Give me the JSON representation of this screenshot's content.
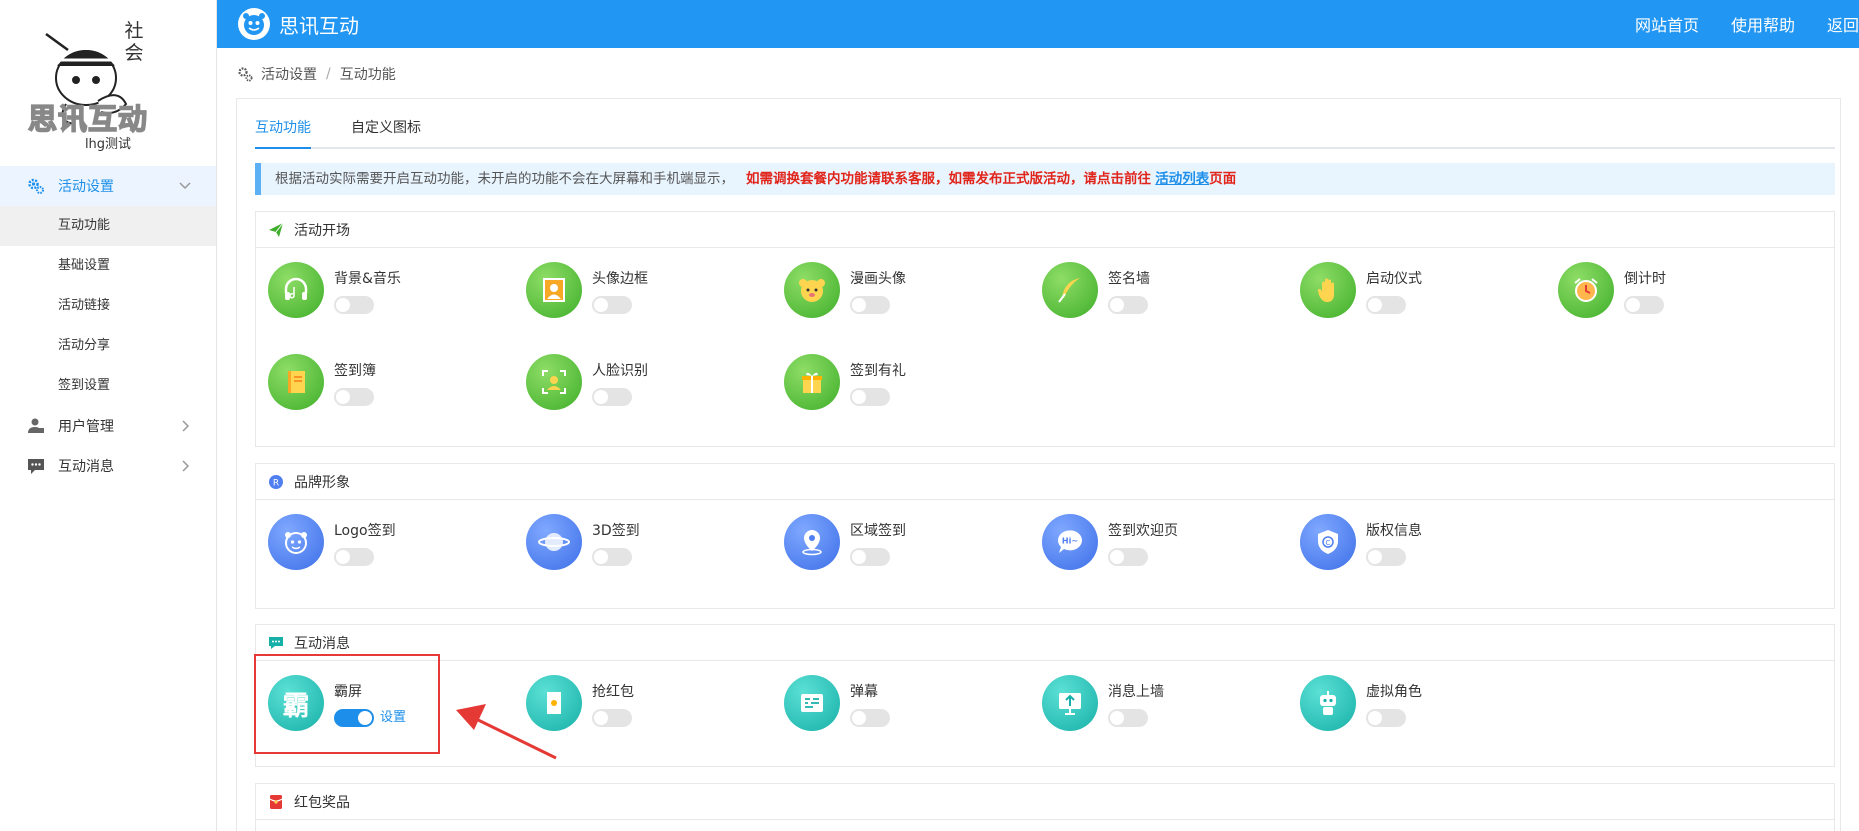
{
  "sidebar": {
    "logo_text": "思讯互动",
    "logo_stamp": "社会",
    "username": "lhg测试",
    "menu": [
      {
        "label": "活动设置",
        "children": [
          "互动功能",
          "基础设置",
          "活动链接",
          "活动分享",
          "签到设置"
        ]
      },
      {
        "label": "用户管理"
      },
      {
        "label": "互动消息"
      }
    ]
  },
  "topbar": {
    "title": "思讯互动",
    "links": [
      "网站首页",
      "使用帮助",
      "返回"
    ]
  },
  "breadcrumb": {
    "items": [
      "活动设置",
      "互动功能"
    ],
    "separator": "/"
  },
  "tabs": [
    "互动功能",
    "自定义图标"
  ],
  "notice": {
    "text": "根据活动实际需要开启互动功能，未开启的功能不会在大屏幕和手机端显示，",
    "warning": "如需调换套餐内功能请联系客服，如需发布正式版活动，请点击前往",
    "link": "活动列表",
    "suffix": "页面"
  },
  "sections": [
    {
      "title": "活动开场",
      "items": [
        {
          "name": "背景&音乐",
          "enabled": false
        },
        {
          "name": "头像边框",
          "enabled": false
        },
        {
          "name": "漫画头像",
          "enabled": false
        },
        {
          "name": "签名墙",
          "enabled": false
        },
        {
          "name": "启动仪式",
          "enabled": false
        },
        {
          "name": "倒计时",
          "enabled": false
        },
        {
          "name": "签到簿",
          "enabled": false
        },
        {
          "name": "人脸识别",
          "enabled": false
        },
        {
          "name": "签到有礼",
          "enabled": false
        }
      ]
    },
    {
      "title": "品牌形象",
      "items": [
        {
          "name": "Logo签到",
          "enabled": false
        },
        {
          "name": "3D签到",
          "enabled": false
        },
        {
          "name": "区域签到",
          "enabled": false
        },
        {
          "name": "签到欢迎页",
          "enabled": false
        },
        {
          "name": "版权信息",
          "enabled": false
        }
      ]
    },
    {
      "title": "互动消息",
      "items": [
        {
          "name": "霸屏",
          "enabled": true,
          "settings_label": "设置",
          "icon_char": "霸"
        },
        {
          "name": "抢红包",
          "enabled": false
        },
        {
          "name": "弹幕",
          "enabled": false
        },
        {
          "name": "消息上墙",
          "enabled": false
        },
        {
          "name": "虚拟角色",
          "enabled": false
        }
      ]
    },
    {
      "title": "红包奖品",
      "items": []
    }
  ],
  "colors": {
    "accent": "#1d8fea",
    "topbar": "#2196f3",
    "warning": "#e1251b",
    "highlight": "#e53935"
  }
}
